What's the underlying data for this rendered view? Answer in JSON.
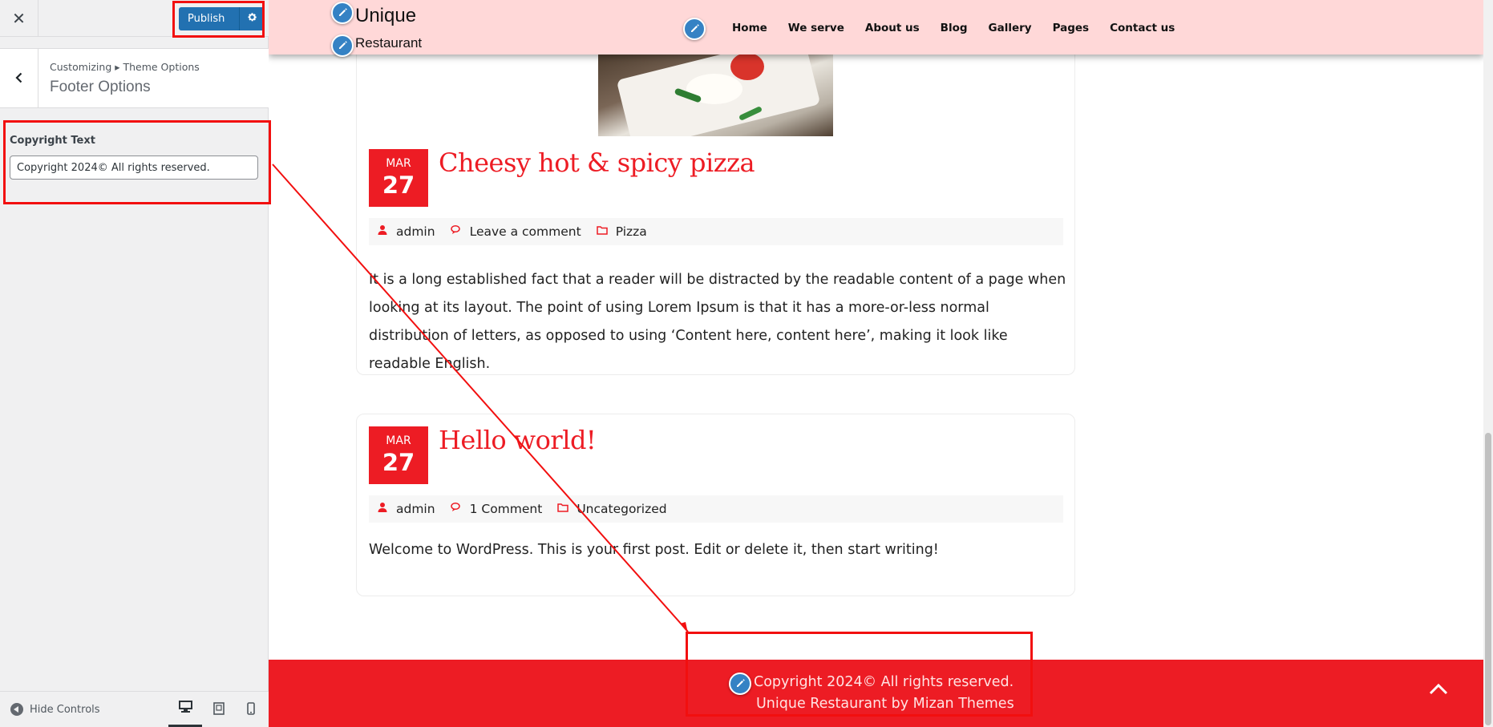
{
  "customizer": {
    "close_label": "✕",
    "publish_label": "Publish",
    "breadcrumb": "Customizing ▸ Theme Options",
    "section_title": "Footer Options",
    "control": {
      "label": "Copyright Text",
      "value": "Copyright 2024© All rights reserved."
    },
    "hide_controls_label": "Hide Controls"
  },
  "site": {
    "title": "Unique",
    "tagline": "Restaurant",
    "nav": [
      "Home",
      "We serve",
      "About us",
      "Blog",
      "Gallery",
      "Pages",
      "Contact us"
    ]
  },
  "posts": [
    {
      "month": "MAR",
      "day": "27",
      "title": "Cheesy hot & spicy pizza",
      "author": "admin",
      "comments": "Leave a comment",
      "category": "Pizza",
      "excerpt": "It is a long established fact that a reader will be distracted by the readable content of a page when looking at its layout. The point of using Lorem Ipsum is that it has a more-or-less normal distribution of letters, as opposed to using ‘Content here, content here’, making it look like readable English."
    },
    {
      "month": "MAR",
      "day": "27",
      "title": "Hello world!",
      "author": "admin",
      "comments": "1 Comment",
      "category": "Uncategorized",
      "excerpt": "Welcome to WordPress. This is your first post. Edit or delete it, then start writing!"
    }
  ],
  "footer": {
    "copyright": "Copyright 2024© All rights reserved.",
    "credit": "Unique Restaurant by Mizan Themes"
  },
  "colors": {
    "accent": "#ed1c24",
    "header_bg": "#ffd8d8",
    "wp_blue": "#2271b1",
    "annotation": "#f20f0f"
  }
}
